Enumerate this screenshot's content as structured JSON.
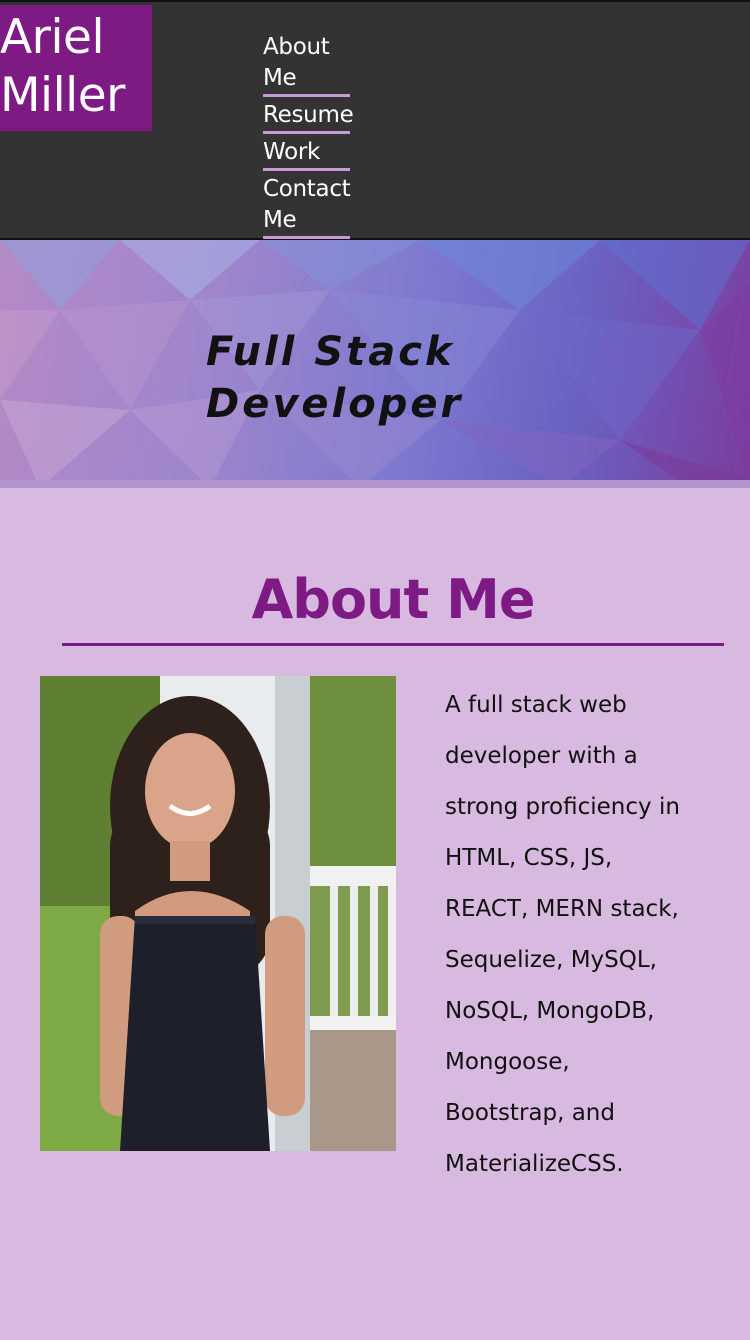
{
  "header": {
    "logo_line1": "Ariel",
    "logo_line2": "Miller",
    "nav": [
      {
        "line1": "About",
        "line2": "Me"
      },
      {
        "line1": "Resume",
        "line2": ""
      },
      {
        "line1": "Work",
        "line2": ""
      },
      {
        "line1": "Contact",
        "line2": "Me"
      }
    ]
  },
  "hero": {
    "line1": "Full Stack",
    "line2": "Developer"
  },
  "about": {
    "title": "About Me",
    "photo_alt": "portrait-photo",
    "bio": "A full stack web\ndeveloper with a\nstrong proficiency in\nHTML, CSS, JS,\nREACT, MERN stack,\nSequelize, MySQL,\nNoSQL, MongoDB,\nMongoose,\nBootstrap, and\nMaterializeCSS."
  },
  "colors": {
    "header_bg": "#333333",
    "brand_purple": "#7d1a84",
    "page_bg": "#d8b9e0",
    "nav_underline": "#c89ad3"
  }
}
